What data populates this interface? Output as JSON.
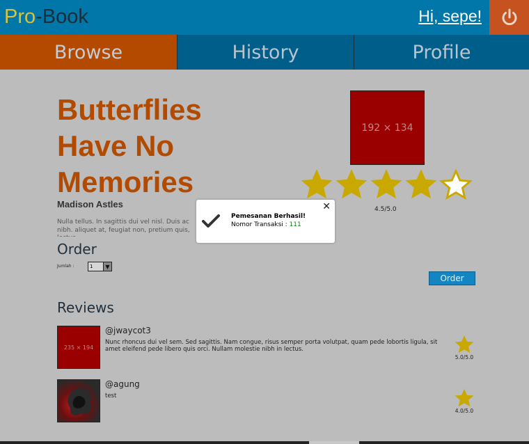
{
  "header": {
    "logo_pro": "Pro",
    "logo_rest": "-Book",
    "greeting": "Hi, sepe!",
    "logout_icon": "power-icon"
  },
  "nav": {
    "tabs": [
      {
        "label": "Browse",
        "active": true
      },
      {
        "label": "History",
        "active": false
      },
      {
        "label": "Profile",
        "active": false
      }
    ]
  },
  "book": {
    "title": "Butterflies Have No Memories",
    "author": "Madison Astles",
    "description": "Nulla tellus. In sagittis dui vel nisl. Duis ac nibh. aliquet at, feugiat non, pretium quis, lectus.",
    "cover_placeholder": "192 × 134",
    "rating_value": 4.5,
    "rating_text": "4.5/5.0"
  },
  "order": {
    "title": "Order",
    "quantity_label": "Jumlah :",
    "quantity_value": "1",
    "button_label": "Order"
  },
  "reviews": {
    "title": "Reviews",
    "items": [
      {
        "username": "@jwaycot3",
        "avatar_placeholder": "235 × 194",
        "text": "Nunc rhoncus dui vel sem. Sed sagittis. Nam congue, risus semper porta volutpat, quam pede lobortis ligula, sit amet eleifend pede libero quis orci. Nullam molestie nibh in lectus.",
        "rating_text": "5.0/5.0"
      },
      {
        "username": "@agung",
        "text": "test",
        "rating_text": "4.0/5.0"
      }
    ]
  },
  "modal": {
    "title": "Pemesanan Berhasil!",
    "body_label": "Nomor Transaksi : ",
    "transaction_number": "111",
    "icon": "check-icon",
    "close_icon": "close-icon"
  },
  "colors": {
    "header_bg": "#0077a8",
    "active_tab": "#b34a00",
    "accent_orange": "#c6531f",
    "star_gold": "#c9a800",
    "title_orange": "#b24a00"
  }
}
